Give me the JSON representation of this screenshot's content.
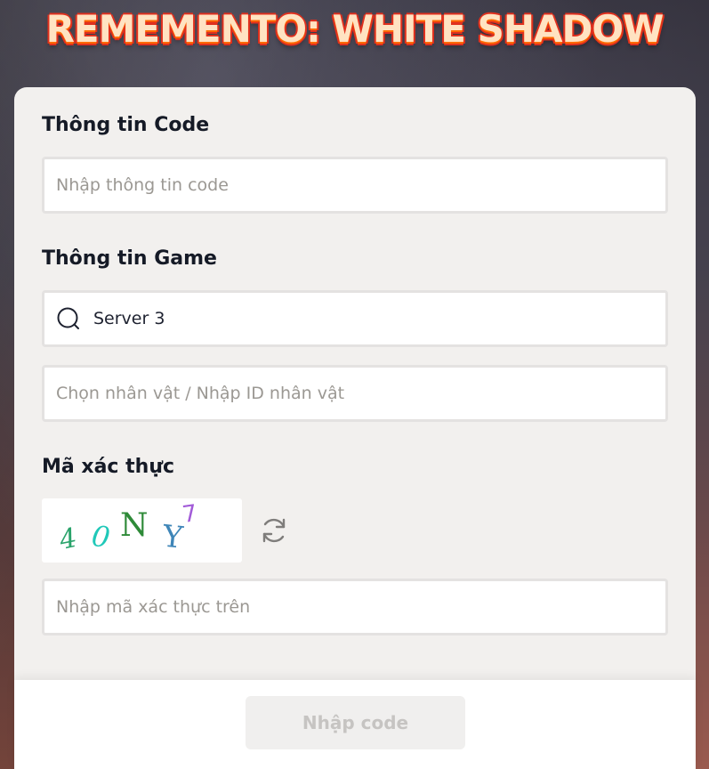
{
  "header": {
    "title": "REMEMENTO: WHITE SHADOW"
  },
  "form": {
    "code_section": {
      "label": "Thông tin Code",
      "input_placeholder": "Nhập thông tin code",
      "input_value": ""
    },
    "game_section": {
      "label": "Thông tin Game",
      "server_value": "Server 3",
      "server_icon": "search-icon",
      "character_placeholder": "Chọn nhân vật / Nhập ID nhân vật",
      "character_value": ""
    },
    "captcha_section": {
      "label": "Mã xác thực",
      "captcha_chars": [
        "4",
        "0",
        "N",
        "Y",
        "7"
      ],
      "refresh_icon": "refresh-icon",
      "input_placeholder": "Nhập mã xác thực trên",
      "input_value": ""
    },
    "submit_label": "Nhập code"
  },
  "colors": {
    "title_fill": "#ffe3c2",
    "title_outline": "#e0301e",
    "card_bg": "#f2f0ee",
    "label_text": "#151a26",
    "placeholder": "#9b9893",
    "submit_disabled_text": "#c6c4c2"
  }
}
